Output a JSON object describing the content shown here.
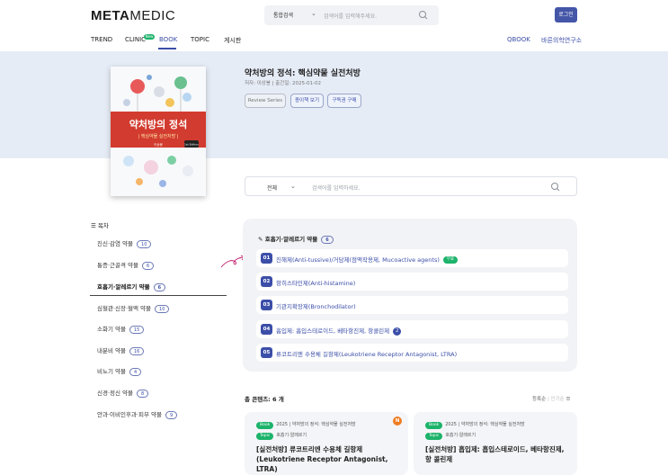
{
  "header": {
    "logo": "METAMEDIC",
    "search": {
      "category": "통합검색",
      "placeholder": "검색어를 입력해주세요."
    },
    "login_label": "로그인"
  },
  "nav": {
    "items": [
      {
        "label": "TREND"
      },
      {
        "label": "CLINIC",
        "badge": "New"
      },
      {
        "label": "BOOK",
        "active": true
      },
      {
        "label": "TOPIC"
      },
      {
        "label": "게시판"
      }
    ],
    "right_items": [
      {
        "label": "QBOOK"
      },
      {
        "label": "바른의학연구소"
      }
    ]
  },
  "book": {
    "cover": {
      "title": "약처방의 정석",
      "subtitle": "| 핵심약물 실전처방 |",
      "edition": "1st Edition",
      "author": "이상봉"
    },
    "title": "약처방의 정석: 핵심약물 실전처방",
    "meta": "저자: 이상봉  |  출간일: 2025-01-02",
    "buttons": [
      "Review Series",
      "종이책 보기",
      "구독권 구매"
    ]
  },
  "content_search": {
    "category": "전체",
    "placeholder": "검색어를 입력하세요."
  },
  "toc": {
    "heading": "목차",
    "items": [
      {
        "label": "진신·감염 약물",
        "count": "10"
      },
      {
        "label": "통증·근골격 약물",
        "count": "6"
      },
      {
        "label": "호흡기·알레르기 약물",
        "count": "6",
        "active": true
      },
      {
        "label": "심혈관·신장·혈액 약물",
        "count": "10"
      },
      {
        "label": "소화기 약물",
        "count": "15"
      },
      {
        "label": "내분비 약물",
        "count": "16"
      },
      {
        "label": "비뇨기 약물",
        "count": "4"
      },
      {
        "label": "신경·정신 약물",
        "count": "8"
      },
      {
        "label": "안과·이비인후과·피부 약물",
        "count": "9"
      }
    ]
  },
  "chapter_panel": {
    "title": "호흡기·알레르기 약물",
    "count": "6",
    "chapters": [
      {
        "num": "01",
        "label": "진해제(Anti-tussive)/거담제(점액작용제, Mucoactive agents)",
        "tag": "무료"
      },
      {
        "num": "02",
        "label": "항히스타민제(Anti-histamine)"
      },
      {
        "num": "03",
        "label": "기관지확장제(Bronchodilator)"
      },
      {
        "num": "04",
        "label": "흡입제: 흡입스테로이드, 베타항진제, 항콜린제",
        "count": "2"
      },
      {
        "num": "05",
        "label": "류코트리엔 수용체 길항제(Leukotriene Receptor Antagonist, LTRA)"
      }
    ]
  },
  "contents": {
    "total_label": "총 콘텐츠: 6 개",
    "sort": {
      "active": "등록순",
      "inactive": "인기순"
    },
    "cards": [
      {
        "book_tag": "Book",
        "path": "2025 | 약처방의 정석: 핵심약물 실전처방",
        "topic_tag": "Topic",
        "topic": "호흡기·알레르기",
        "title": "[실전처방] 류코트리엔 수용체 길항제(Leukotriene Receptor Antagonist, LTRA)",
        "badge": "N"
      },
      {
        "book_tag": "Book",
        "path": "2025 | 약처방의 정석: 핵심약물 실전처방",
        "topic_tag": "Topic",
        "topic": "호흡기·알레르기",
        "title": "[실전처방] 흡입제: 흡입스테로이드, 베타항진제, 항 콜린제"
      }
    ]
  },
  "colors": {
    "brand": "#3b4ea8",
    "hero_bg": "#e6ecf6",
    "green": "#1cb36a",
    "orange": "#ef7c22"
  }
}
